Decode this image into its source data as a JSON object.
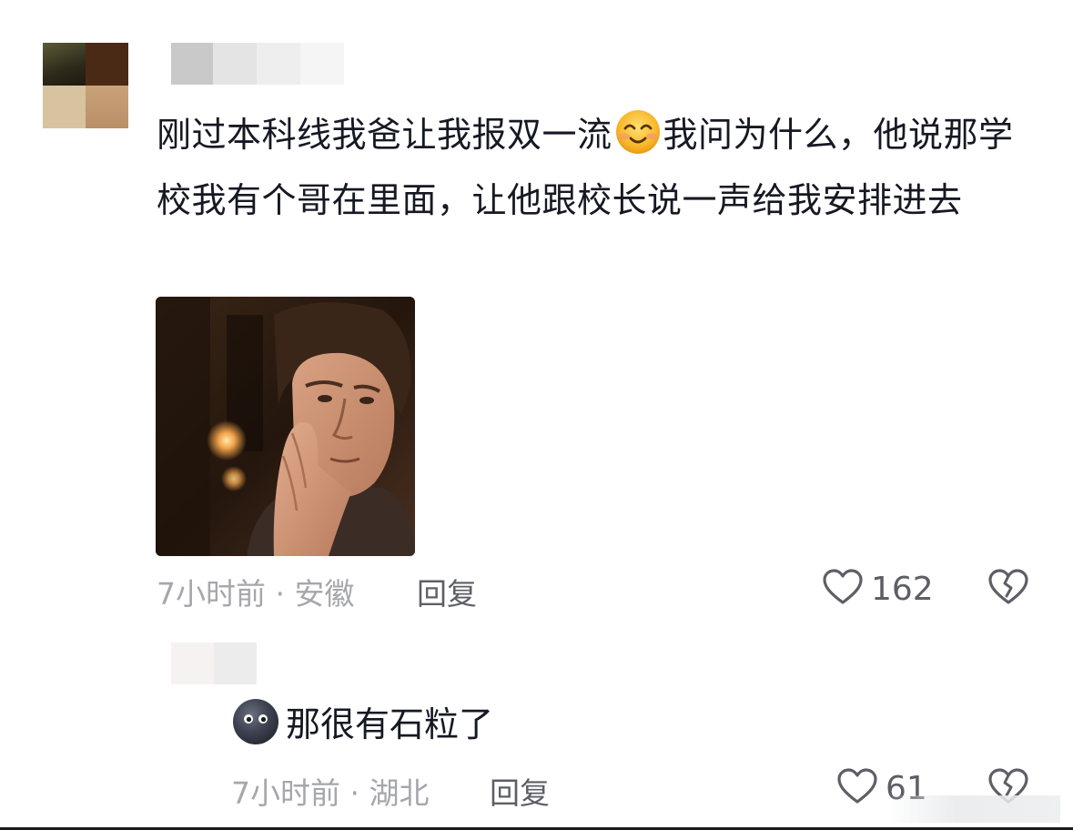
{
  "comment": {
    "text": "刚过本科线我爸让我报双一流",
    "text_after_emoji": "我问为什么，他说那学校我有个哥在里面，让他跟校长说一声给我安排进去",
    "emoji_icon": "smiling-face-emoji",
    "image_icon": "thinking-man-photo",
    "time_location": "7小时前 · 安徽",
    "reply_label": "回复",
    "like_count": "162"
  },
  "reply": {
    "emoji_icon": "dark-round-face-emoji",
    "text": "那很有石粒了",
    "time_location": "7小时前 · 湖北",
    "reply_label": "回复",
    "like_count": "61"
  },
  "colors": {
    "text_primary": "#161823",
    "text_secondary": "#a6a7ab",
    "action_gray": "#5e5f66"
  }
}
